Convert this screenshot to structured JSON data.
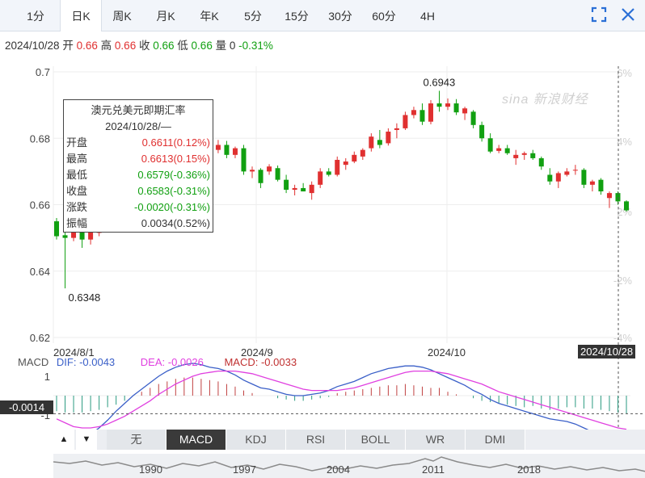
{
  "tabs": [
    "1分",
    "日K",
    "周K",
    "月K",
    "年K",
    "5分",
    "15分",
    "30分",
    "60分",
    "4H"
  ],
  "active_tab": "日K",
  "icons": {
    "fullscreen": "fullscreen-icon",
    "close": "close-icon"
  },
  "info_line": {
    "date": "2024/10/28",
    "open_label": "开",
    "open": "0.66",
    "high_label": "高",
    "high": "0.66",
    "close_label": "收",
    "close": "0.66",
    "low_label": "低",
    "low": "0.66",
    "vol_label": "量",
    "vol": "0",
    "change": "-0.31%"
  },
  "watermark": "sina 新浪财经",
  "tooltip": {
    "title": "澳元兑美元即期汇率",
    "date": "2024/10/28/—",
    "rows": [
      {
        "k": "开盘",
        "v": "0.6611(0.12%)",
        "color": "#e03030"
      },
      {
        "k": "最高",
        "v": "0.6613(0.15%)",
        "color": "#e03030"
      },
      {
        "k": "最低",
        "v": "0.6579(-0.36%)",
        "color": "#11a011"
      },
      {
        "k": "收盘",
        "v": "0.6583(-0.31%)",
        "color": "#11a011"
      },
      {
        "k": "涨跌",
        "v": "-0.0020(-0.31%)",
        "color": "#11a011"
      },
      {
        "k": "振幅",
        "v": "0.0034(0.52%)",
        "color": "#333333"
      }
    ]
  },
  "macd_header": {
    "name": "MACD",
    "dif": "DIF: -0.0043",
    "dea": "DEA: -0.0026",
    "macd": "MACD: -0.0033"
  },
  "crosshair": {
    "date": "2024/10/28",
    "macd_value": "-0.0014"
  },
  "indicator_tabs": [
    "无",
    "MACD",
    "KDJ",
    "RSI",
    "BOLL",
    "WR",
    "DMI"
  ],
  "active_indicator": "MACD",
  "overview_years": [
    "1990",
    "1997",
    "2004",
    "2011",
    "2018"
  ],
  "chart_data": {
    "type": "candlestick",
    "title": "澳元兑美元即期汇率",
    "y_ticks": [
      "0.7",
      "0.68",
      "0.66",
      "0.64",
      "0.62"
    ],
    "y_tick_values": [
      0.7,
      0.68,
      0.66,
      0.64,
      0.62
    ],
    "pct_ticks": [
      "6%",
      "4%",
      "2%",
      "-2%",
      "-4%"
    ],
    "x_ticks": [
      "2024/8/1",
      "2024/9",
      "2024/10"
    ],
    "annotations": {
      "max": "0.6943",
      "min": "0.6348"
    },
    "colors": {
      "up": "#e03030",
      "down": "#11a011",
      "dif": "#3a5fc8",
      "dea": "#e040e0"
    },
    "ohlc": [
      [
        0.655,
        0.656,
        0.6495,
        0.6505
      ],
      [
        0.6508,
        0.654,
        0.6348,
        0.65
      ],
      [
        0.65,
        0.653,
        0.649,
        0.652
      ],
      [
        0.6522,
        0.656,
        0.647,
        0.6495
      ],
      [
        0.6495,
        0.653,
        0.648,
        0.6518
      ],
      [
        0.6515,
        0.6555,
        0.6505,
        0.654
      ],
      [
        0.654,
        0.658,
        0.653,
        0.6575
      ],
      [
        0.6572,
        0.659,
        0.656,
        0.6565
      ],
      [
        0.6565,
        0.661,
        0.6555,
        0.66
      ],
      [
        0.66,
        0.664,
        0.659,
        0.663
      ],
      [
        0.663,
        0.666,
        0.6615,
        0.665
      ],
      [
        0.665,
        0.669,
        0.664,
        0.668
      ],
      [
        0.668,
        0.671,
        0.6665,
        0.6698
      ],
      [
        0.6698,
        0.6745,
        0.669,
        0.6735
      ],
      [
        0.6735,
        0.676,
        0.672,
        0.6745
      ],
      [
        0.6745,
        0.678,
        0.6725,
        0.677
      ],
      [
        0.677,
        0.679,
        0.6748,
        0.676
      ],
      [
        0.676,
        0.678,
        0.6745,
        0.6775
      ],
      [
        0.6775,
        0.679,
        0.6755,
        0.6765
      ],
      [
        0.6765,
        0.6795,
        0.6755,
        0.678
      ],
      [
        0.678,
        0.6792,
        0.674,
        0.675
      ],
      [
        0.675,
        0.6775,
        0.674,
        0.677
      ],
      [
        0.677,
        0.678,
        0.669,
        0.67
      ],
      [
        0.67,
        0.6715,
        0.668,
        0.6705
      ],
      [
        0.6705,
        0.671,
        0.665,
        0.6665
      ],
      [
        0.67,
        0.6722,
        0.669,
        0.6715
      ],
      [
        0.671,
        0.6718,
        0.667,
        0.6675
      ],
      [
        0.6675,
        0.669,
        0.6635,
        0.6645
      ],
      [
        0.6645,
        0.666,
        0.6628,
        0.665
      ],
      [
        0.665,
        0.6665,
        0.664,
        0.664
      ],
      [
        0.6635,
        0.667,
        0.6615,
        0.666
      ],
      [
        0.666,
        0.671,
        0.665,
        0.67
      ],
      [
        0.67,
        0.671,
        0.6685,
        0.669
      ],
      [
        0.669,
        0.6745,
        0.6685,
        0.6735
      ],
      [
        0.672,
        0.674,
        0.6705,
        0.673
      ],
      [
        0.673,
        0.676,
        0.6725,
        0.675
      ],
      [
        0.6745,
        0.677,
        0.6735,
        0.6765
      ],
      [
        0.677,
        0.6815,
        0.676,
        0.6805
      ],
      [
        0.6795,
        0.6825,
        0.677,
        0.678
      ],
      [
        0.6785,
        0.683,
        0.6778,
        0.682
      ],
      [
        0.6825,
        0.6845,
        0.68,
        0.683
      ],
      [
        0.683,
        0.688,
        0.6825,
        0.687
      ],
      [
        0.687,
        0.6895,
        0.686,
        0.6885
      ],
      [
        0.6885,
        0.6905,
        0.684,
        0.685
      ],
      [
        0.685,
        0.6915,
        0.6842,
        0.6905
      ],
      [
        0.6905,
        0.6943,
        0.688,
        0.6895
      ],
      [
        0.6895,
        0.692,
        0.6885,
        0.6905
      ],
      [
        0.6905,
        0.6918,
        0.687,
        0.6878
      ],
      [
        0.6875,
        0.6895,
        0.6855,
        0.689
      ],
      [
        0.688,
        0.6885,
        0.683,
        0.684
      ],
      [
        0.684,
        0.685,
        0.679,
        0.68
      ],
      [
        0.68,
        0.6815,
        0.6755,
        0.676
      ],
      [
        0.6762,
        0.678,
        0.6755,
        0.677
      ],
      [
        0.677,
        0.678,
        0.675,
        0.6755
      ],
      [
        0.674,
        0.6765,
        0.672,
        0.675
      ],
      [
        0.675,
        0.676,
        0.6735,
        0.6755
      ],
      [
        0.6755,
        0.6765,
        0.6735,
        0.674
      ],
      [
        0.674,
        0.6745,
        0.6705,
        0.6715
      ],
      [
        0.669,
        0.671,
        0.666,
        0.667
      ],
      [
        0.667,
        0.67,
        0.665,
        0.6695
      ],
      [
        0.669,
        0.671,
        0.6685,
        0.67
      ],
      [
        0.6705,
        0.672,
        0.669,
        0.6705
      ],
      [
        0.6705,
        0.671,
        0.665,
        0.666
      ],
      [
        0.666,
        0.6675,
        0.664,
        0.667
      ],
      [
        0.6675,
        0.668,
        0.663,
        0.664
      ],
      [
        0.662,
        0.664,
        0.659,
        0.6635
      ],
      [
        0.6635,
        0.664,
        0.66,
        0.661
      ],
      [
        0.661,
        0.6613,
        0.6579,
        0.6583
      ]
    ],
    "macd": [
      -0.0012,
      -0.0013,
      -0.0013,
      -0.0013,
      -0.0012,
      -0.0011,
      -0.0009,
      -0.0007,
      -0.0004,
      0.0,
      0.0003,
      0.0006,
      0.0009,
      0.0011,
      0.0013,
      0.0014,
      0.0014,
      0.0013,
      0.0012,
      0.0011,
      0.0009,
      0.0007,
      0.0004,
      0.0002,
      0.0,
      0.0,
      -0.0002,
      -0.0003,
      -0.0004,
      -0.0004,
      -0.0003,
      -0.0002,
      -0.0001,
      0.0002,
      0.0003,
      0.0004,
      0.0005,
      0.0006,
      0.0007,
      0.0008,
      0.0008,
      0.0009,
      0.0008,
      0.0007,
      0.0006,
      0.0006,
      0.0003,
      0.0001,
      0.0,
      -0.0002,
      -0.0004,
      -0.0005,
      -0.0006,
      -0.0007,
      -0.0008,
      -0.0009,
      -0.0008,
      -0.001,
      -0.0011,
      -0.001,
      -0.0009,
      -0.0009,
      -0.001,
      -0.001,
      -0.0011,
      -0.0012,
      -0.0013,
      -0.0014
    ],
    "dif": [
      -0.003,
      -0.0034,
      -0.0035,
      -0.0034,
      -0.003,
      -0.0025,
      -0.0019,
      -0.0012,
      -0.0006,
      0.0,
      0.0005,
      0.001,
      0.0015,
      0.0019,
      0.0022,
      0.0024,
      0.0025,
      0.0024,
      0.0022,
      0.0021,
      0.0019,
      0.0016,
      0.0012,
      0.0009,
      0.0006,
      0.0005,
      0.0003,
      0.0001,
      0.0,
      0.0,
      0.0001,
      0.0002,
      0.0004,
      0.0007,
      0.0009,
      0.0011,
      0.0014,
      0.0017,
      0.0019,
      0.0021,
      0.0022,
      0.0023,
      0.0023,
      0.0022,
      0.002,
      0.0017,
      0.0014,
      0.0011,
      0.0008,
      0.0004,
      0.0001,
      -0.0003,
      -0.0006,
      -0.0008,
      -0.001,
      -0.0012,
      -0.0014,
      -0.0016,
      -0.0018,
      -0.0019,
      -0.002,
      -0.0022,
      -0.0025,
      -0.0028,
      -0.0031,
      -0.0034,
      -0.0039,
      -0.0043
    ],
    "dea": [
      -0.0018,
      -0.0021,
      -0.0024,
      -0.0025,
      -0.0025,
      -0.0024,
      -0.0022,
      -0.0019,
      -0.0016,
      -0.0012,
      -0.0008,
      -0.0004,
      0.0001,
      0.0005,
      0.0009,
      0.0012,
      0.0015,
      0.0017,
      0.0018,
      0.0019,
      0.0019,
      0.0019,
      0.0018,
      0.0017,
      0.0015,
      0.0013,
      0.0011,
      0.0009,
      0.0007,
      0.0005,
      0.0004,
      0.0004,
      0.0004,
      0.0004,
      0.0005,
      0.0006,
      0.0008,
      0.001,
      0.0012,
      0.0014,
      0.0016,
      0.0018,
      0.0019,
      0.0019,
      0.0019,
      0.0018,
      0.0017,
      0.0015,
      0.0013,
      0.0011,
      0.0009,
      0.0006,
      0.0003,
      0.0001,
      -0.0001,
      -0.0003,
      -0.0005,
      -0.0007,
      -0.0009,
      -0.0011,
      -0.0013,
      -0.0015,
      -0.0017,
      -0.0019,
      -0.0021,
      -0.0023,
      -0.0025,
      -0.0026
    ],
    "macd_y_ticks": [
      "1",
      "-1"
    ]
  }
}
